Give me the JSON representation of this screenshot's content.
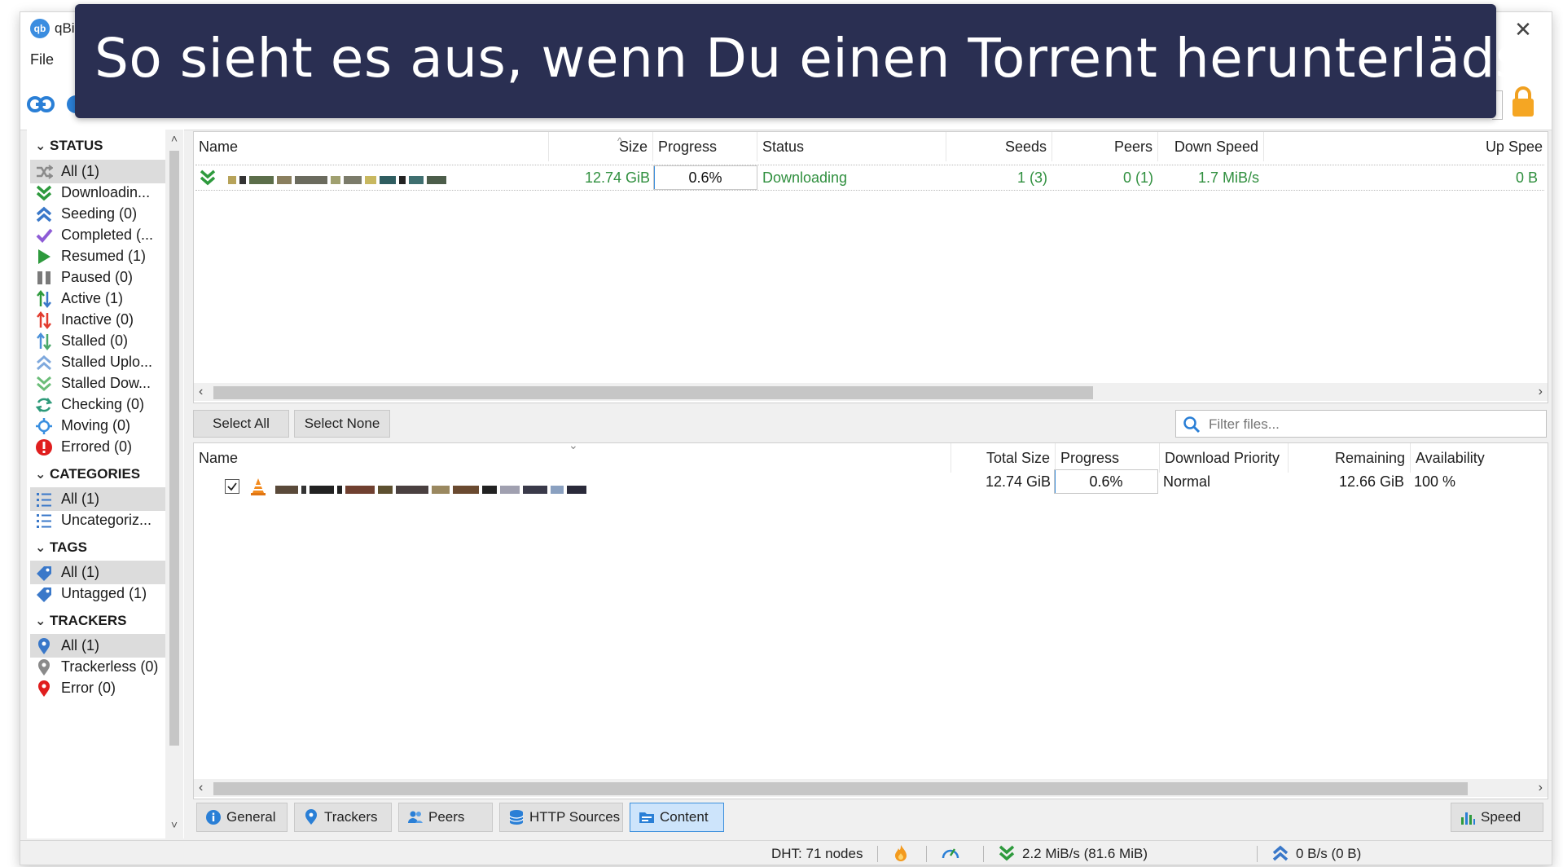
{
  "window": {
    "title": "qBi",
    "app_icon_text": "qb",
    "close_glyph": "✕"
  },
  "menu": {
    "file": "File"
  },
  "banner": {
    "text": "So sieht es aus, wenn Du einen Torrent herunterlädst"
  },
  "sidebar": {
    "status": {
      "header": "STATUS",
      "items": [
        {
          "label": "All (1)",
          "icon": "shuffle-icon",
          "selected": true
        },
        {
          "label": "Downloadin...",
          "icon": "download-icon"
        },
        {
          "label": "Seeding (0)",
          "icon": "upload-icon"
        },
        {
          "label": "Completed (...",
          "icon": "check-icon"
        },
        {
          "label": "Resumed (1)",
          "icon": "play-icon"
        },
        {
          "label": "Paused (0)",
          "icon": "pause-icon"
        },
        {
          "label": "Active (1)",
          "icon": "active-arrows-icon"
        },
        {
          "label": "Inactive (0)",
          "icon": "inactive-arrows-icon"
        },
        {
          "label": "Stalled (0)",
          "icon": "stalled-arrows-icon"
        },
        {
          "label": "Stalled Uplo...",
          "icon": "stalled-upload-icon"
        },
        {
          "label": "Stalled Dow...",
          "icon": "stalled-download-icon"
        },
        {
          "label": "Checking (0)",
          "icon": "refresh-icon"
        },
        {
          "label": "Moving (0)",
          "icon": "move-icon"
        },
        {
          "label": "Errored (0)",
          "icon": "error-icon"
        }
      ]
    },
    "categories": {
      "header": "CATEGORIES",
      "items": [
        {
          "label": "All (1)",
          "selected": true
        },
        {
          "label": "Uncategoriz..."
        }
      ]
    },
    "tags": {
      "header": "TAGS",
      "items": [
        {
          "label": "All (1)",
          "selected": true
        },
        {
          "label": "Untagged (1)"
        }
      ]
    },
    "trackers": {
      "header": "TRACKERS",
      "items": [
        {
          "label": "All (1)",
          "selected": true
        },
        {
          "label": "Trackerless (0)"
        },
        {
          "label": "Error (0)"
        }
      ]
    }
  },
  "torrent_table": {
    "columns": [
      "Name",
      "Size",
      "Progress",
      "Status",
      "Seeds",
      "Peers",
      "Down Speed",
      "Up Spee"
    ],
    "row": {
      "size": "12.74 GiB",
      "progress": "0.6%",
      "progress_fraction": 0.006,
      "status": "Downloading",
      "seeds": "1 (3)",
      "peers": "0 (1)",
      "down_speed": "1.7 MiB/s",
      "up_speed": "0 B"
    }
  },
  "content_toolbar": {
    "select_all": "Select All",
    "select_none": "Select None",
    "filter_placeholder": "Filter files..."
  },
  "content_table": {
    "columns": [
      "Name",
      "Total Size",
      "Progress",
      "Download Priority",
      "Remaining",
      "Availability"
    ],
    "row": {
      "checked": true,
      "total_size": "12.74 GiB",
      "progress": "0.6%",
      "progress_fraction": 0.006,
      "priority": "Normal",
      "remaining": "12.66 GiB",
      "availability": "100 %"
    }
  },
  "tabs": [
    {
      "label": "General",
      "icon": "info-icon"
    },
    {
      "label": "Trackers",
      "icon": "location-pin-icon"
    },
    {
      "label": "Peers",
      "icon": "people-icon"
    },
    {
      "label": "HTTP Sources",
      "icon": "database-icon"
    },
    {
      "label": "Content",
      "icon": "folder-icon",
      "active": true
    }
  ],
  "speed_button": {
    "label": "Speed",
    "icon": "bar-chart-icon"
  },
  "statusbar": {
    "dht": "DHT: 71 nodes",
    "download": "2.2 MiB/s (81.6 MiB)",
    "upload": "0 B/s (0 B)"
  },
  "colors": {
    "banner_bg": "#2a2f52",
    "download_green": "#2f8f3e",
    "active_tab": "#cde4fb",
    "accent_blue": "#3c8fdc"
  }
}
